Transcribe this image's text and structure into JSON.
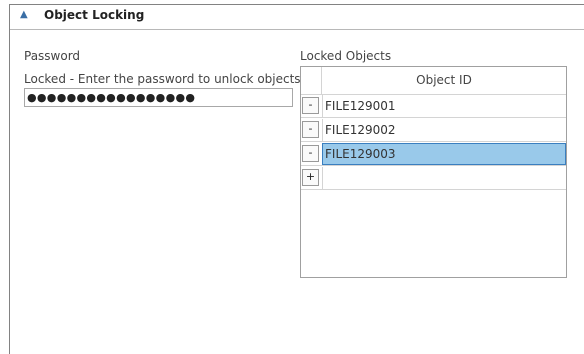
{
  "section": {
    "title": "Object Locking",
    "collapse_icon": "chevron-up-icon"
  },
  "password": {
    "label": "Password",
    "status_label": "Locked - Enter the password to unlock objects",
    "value": "●●●●●●●●●●●●●●●●●"
  },
  "locked_objects": {
    "label": "Locked Objects",
    "column_header": "Object ID",
    "remove_button_label": "-",
    "add_button_label": "+",
    "rows": [
      {
        "id": "FILE129001"
      },
      {
        "id": "FILE129002"
      },
      {
        "id": "FILE129003"
      }
    ],
    "selected_row": "FILE129003"
  },
  "colors": {
    "selection": "#99c9ea",
    "accent": "#3a6ea5"
  }
}
